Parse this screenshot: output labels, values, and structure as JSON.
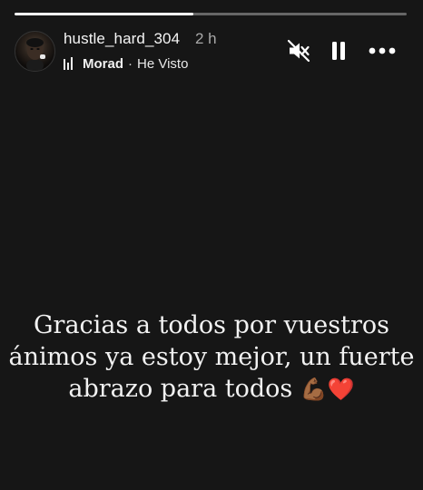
{
  "story": {
    "progress_fraction": 0.455,
    "username": "hustle_hard_304",
    "timestamp": "2 h",
    "music": {
      "artist": "Morad",
      "separator": "·",
      "track": "He Visto"
    },
    "controls": {
      "mute_icon": "speaker-muted-icon",
      "pause_icon": "pause-icon",
      "more_icon": "more-options-icon"
    },
    "caption_lines": [
      "Gracias a todos por vuestros",
      "ánimos ya estoy mejor, un fuerte",
      "abrazo para todos"
    ],
    "caption_emojis": {
      "muscle": "💪🏾",
      "heart": "❤️"
    },
    "colors": {
      "background": "#161616",
      "text": "#f2f2f2",
      "muted_text": "#a8a8a8",
      "heart": "#e0243d"
    }
  }
}
